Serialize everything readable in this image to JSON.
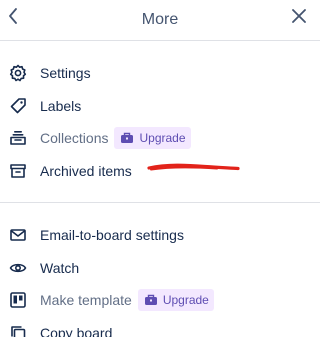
{
  "header": {
    "title": "More",
    "back_icon": "chevron-left-icon",
    "close_icon": "close-icon"
  },
  "menu_top": [
    {
      "label": "Settings",
      "icon": "gear-icon"
    },
    {
      "label": "Labels",
      "icon": "tag-icon"
    },
    {
      "label": "Collections",
      "icon": "collections-icon",
      "badge": "Upgrade",
      "badge_icon": "briefcase-icon",
      "disabled": true
    },
    {
      "label": "Archived items",
      "icon": "archive-icon"
    }
  ],
  "menu_bottom": [
    {
      "label": "Email-to-board settings",
      "icon": "email-icon"
    },
    {
      "label": "Watch",
      "icon": "eye-icon"
    },
    {
      "label": "Make template",
      "icon": "template-icon",
      "badge": "Upgrade",
      "badge_icon": "briefcase-icon",
      "disabled": true
    },
    {
      "label": "Copy board",
      "icon": "copy-icon"
    }
  ],
  "colors": {
    "text": "#172b4d",
    "muted": "#626f86",
    "badge_bg": "#f3e8ff",
    "badge_text": "#5e4db2",
    "annotation": "#e2231a"
  }
}
